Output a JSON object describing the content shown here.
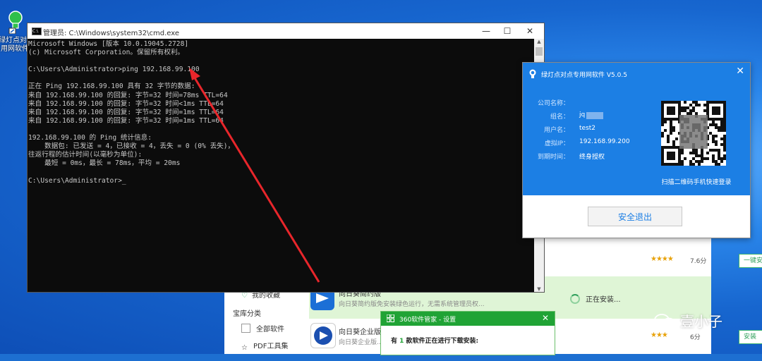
{
  "desktop": {
    "icon_label_line1": "绿灯点对点",
    "icon_label_line2": "用网软件"
  },
  "cmd": {
    "title": "管理员: C:\\Windows\\system32\\cmd.exe",
    "lines": [
      "Microsoft Windows [版本 10.0.19045.2728]",
      "(c) Microsoft Corporation。保留所有权利。",
      "",
      "C:\\Users\\Administrator>ping 192.168.99.100",
      "",
      "正在 Ping 192.168.99.100 具有 32 字节的数据:",
      "来自 192.168.99.100 的回复: 字节=32 时间=78ms TTL=64",
      "来自 192.168.99.100 的回复: 字节=32 时间<1ms TTL=64",
      "来自 192.168.99.100 的回复: 字节=32 时间=1ms TTL=64",
      "来自 192.168.99.100 的回复: 字节=32 时间=1ms TTL=64",
      "",
      "192.168.99.100 的 Ping 统计信息:",
      "    数据包: 已发送 = 4，已接收 = 4，丢失 = 0 (0% 丢失)，",
      "往返行程的估计时间(以毫秒为单位):",
      "    最短 = 0ms，最长 = 78ms，平均 = 20ms",
      "",
      "C:\\Users\\Administrator>_"
    ]
  },
  "client": {
    "title": "绿灯点对点专用网软件 V5.0.5",
    "fields": [
      {
        "key": "公司名称：",
        "value": ""
      },
      {
        "key": "组名：",
        "value": "jq"
      },
      {
        "key": "用户名：",
        "value": "test2"
      },
      {
        "key": "虚拟IP：",
        "value": "192.168.99.200"
      },
      {
        "key": "到期时间：",
        "value": "终身授权"
      }
    ],
    "qr_caption": "扫描二维码手机快速登录",
    "logout_label": "安全退出"
  },
  "store": {
    "favorites": "我的收藏",
    "category_header": "宝库分类",
    "category_items": [
      "全部软件",
      "PDF工具集"
    ],
    "apps": [
      {
        "name": "",
        "desc": "",
        "stars": "★★★★",
        "score": "7.6分",
        "button": "一键安装"
      },
      {
        "name": "向日葵简约版",
        "desc": "向日葵简约版免安装绿色运行，无需系统管理员权...",
        "status": "正在安装..."
      },
      {
        "name": "向日葵企业版",
        "desc": "向日葵企业版...",
        "stars": "★★★",
        "score": "6分",
        "button": "安装"
      }
    ]
  },
  "popup": {
    "title": "360软件管家 - 设置",
    "msg_prefix": "有 ",
    "msg_count": "1",
    "msg_suffix": " 款软件正在进行下载安装:"
  },
  "watermark": "壹小子",
  "colors": {
    "client_blue": "#1c7fe4",
    "store_green": "#20a335",
    "annotation_red": "#e8262b"
  }
}
